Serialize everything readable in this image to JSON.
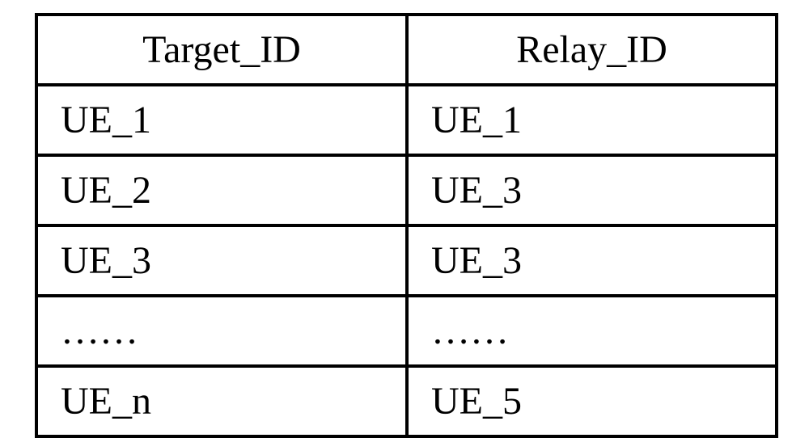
{
  "table": {
    "headers": {
      "target": "Target_ID",
      "relay": "Relay_ID"
    },
    "rows": [
      {
        "target": "UE_1",
        "relay": "UE_1"
      },
      {
        "target": "UE_2",
        "relay": "UE_3"
      },
      {
        "target": "UE_3",
        "relay": "UE_3"
      },
      {
        "target": "……",
        "relay": "……"
      },
      {
        "target": "UE_n",
        "relay": "UE_5"
      }
    ]
  }
}
